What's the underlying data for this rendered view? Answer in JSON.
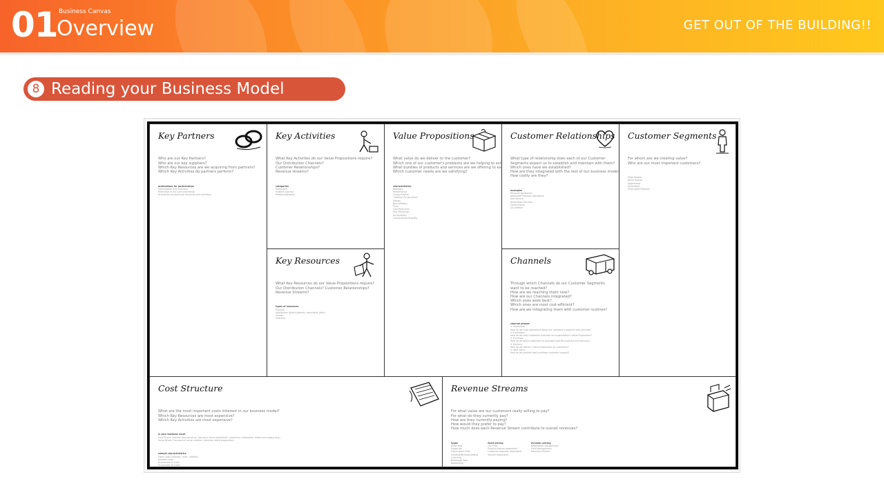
{
  "header": {
    "chapter_number": "01",
    "chapter_subtitle": "Business Canvas",
    "chapter_title": "Overview",
    "slogan": "GET OUT OF THE BUILDING!!"
  },
  "section": {
    "number": "8",
    "title": "Reading your Business Model"
  },
  "canvas": {
    "key_partners": {
      "title": "Key Partners",
      "questions": "Who are our Key Partners?\nWho are our key suppliers?\nWhich Key Resources are we acquiring from partners?\nWhich Key Activities do partners perform?",
      "extra_heading": "motivations for partnerships",
      "extra": "Optimization and economy\nReduction of risk and uncertainty\nAcquisition of particular resources and activities"
    },
    "key_activities": {
      "title": "Key Activities",
      "questions": "What Key Activities do our Value Propositions require?\nOur Distribution Channels?\nCustomer Relationships?\nRevenue streams?",
      "extra_heading": "categories",
      "extra": "Production\nProblem Solving\nPlatform/Network"
    },
    "key_resources": {
      "title": "Key Resources",
      "questions": "What Key Resources do our Value Propositions require?\nOur Distribution Channels? Customer Relationships?\nRevenue Streams?",
      "extra_heading": "types of resources",
      "extra": "Physical\nIntellectual (brand patents, copyrights, data)\nHuman\nFinancial"
    },
    "value_propositions": {
      "title": "Value Propositions",
      "questions": "What value do we deliver to the customer?\nWhich one of our customer's problems are we helping to solve?\nWhat bundles of products and services are we offering to each Customer Segment?\nWhich customer needs are we satisfying?",
      "extra_heading": "characteristics",
      "extra": "Newness\nPerformance\nCustomization\n\"Getting the Job Done\"\nDesign\nBrand/Status\nPrice\nCost Reduction\nRisk Reduction\nAccessibility\nConvenience/Usability"
    },
    "customer_relationships": {
      "title": "Customer Relationships",
      "questions": "What type of relationship does each of our Customer\nSegments expect us to establish and maintain with them?\nWhich ones have we established?\nHow are they integrated with the rest of our business model?\nHow costly are they?",
      "extra_heading": "examples",
      "extra": "Personal assistance\nDedicated Personal Assistance\nSelf-Service\nAutomated Services\nCommunities\nCo-creation"
    },
    "channels": {
      "title": "Channels",
      "questions": "Through which Channels do our Customer Segments\nwant to be reached?\nHow are we reaching them now?\nHow are our Channels integrated?\nWhich ones work best?\nWhich ones are most cost-efficient?\nHow are we integrating them with customer routines?",
      "extra_heading": "channel phases",
      "extra": "1. Awareness\nHow do we raise awareness about our company's products and services?\n2. Evaluation\nHow do we help customers evaluate our organization's Value Proposition?\n3. Purchase\nHow do we allow customers to purchase specific products and services?\n4. Delivery\nHow do we deliver a Value Proposition to customers?\n5. After sales\nHow do we provide post-purchase customer support?"
    },
    "customer_segments": {
      "title": "Customer Segments",
      "questions": "For whom are we creating value?\nWho are our most important customers?",
      "extra_heading": "",
      "extra": "Mass Market\nNiche Market\nSegmented\nDiversified\nMulti-sided Platform"
    },
    "cost_structure": {
      "title": "Cost Structure",
      "questions": "What are the most important costs inherent in our business model?\nWhich Key Resources are most expensive?\nWhich Key Activities are most expensive?",
      "extra_heading": "is your business more",
      "extra": "Cost Driven (leanest cost structure, low price value proposition, maximum automation, extensive outsourcing)\nValue Driven (focused on value creation, premium value proposition)",
      "extra2_heading": "sample characteristics",
      "extra2": "Fixed Costs (salaries, rents, utilities)\nVariable costs\nEconomies of scale\nEconomies of scope"
    },
    "revenue_streams": {
      "title": "Revenue Streams",
      "questions": "For what value are our customers really willing to pay?\nFor what do they currently pay?\nHow are they currently paying?\nHow would they prefer to pay?\nHow much does each Revenue Stream contribute to overall revenues?",
      "col1_heading": "types",
      "col1": "Asset sale\nUsage fee\nSubscription Fees\nLending/Renting/Leasing\nLicensing\nBrokerage fees\nAdvertising",
      "col2_heading": "fixed pricing",
      "col2": "List Price\nProduct feature dependent\nCustomer segment dependent\nVolume dependent",
      "col3_heading": "dynamic pricing",
      "col3": "Negotiation (bargaining)\nYield Management\nReal-time-Market"
    }
  },
  "colors": {
    "header_start": "#f7632a",
    "header_end": "#ffc81c",
    "pill": "#d9553a"
  },
  "icons": {
    "key_partners": "chain-links-icon",
    "key_activities": "worker-icon",
    "key_resources": "workman-icon",
    "value_propositions": "gift-icon",
    "customer_relationships": "heart-icon",
    "channels": "truck-icon",
    "customer_segments": "person-icon",
    "cost_structure": "price-tag-icon",
    "revenue_streams": "cash-register-icon"
  }
}
